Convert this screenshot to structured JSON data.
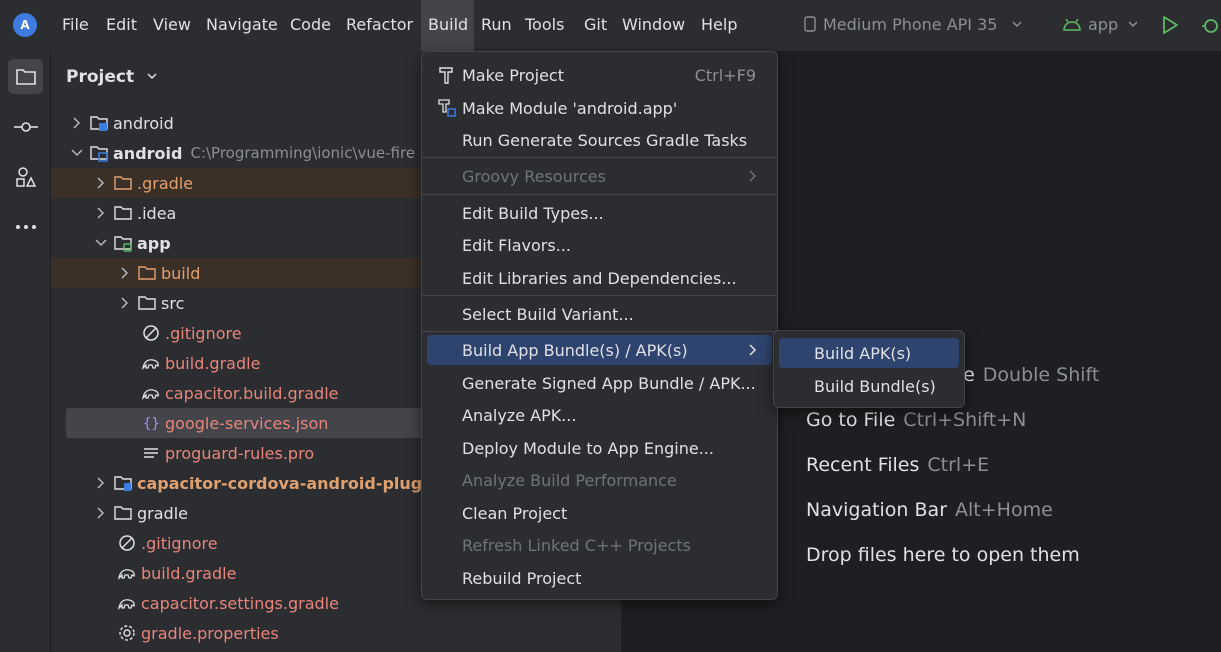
{
  "menubar": {
    "items": [
      {
        "label": "File",
        "mnemonic": "F"
      },
      {
        "label": "Edit",
        "mnemonic": "E"
      },
      {
        "label": "View",
        "mnemonic": "V"
      },
      {
        "label": "Navigate",
        "mnemonic": "N"
      },
      {
        "label": "Code",
        "mnemonic": "C"
      },
      {
        "label": "Refactor",
        "mnemonic": "R"
      },
      {
        "label": "Build",
        "mnemonic": "B"
      },
      {
        "label": "Run",
        "mnemonic": "u"
      },
      {
        "label": "Tools",
        "mnemonic": "T"
      },
      {
        "label": "Git",
        "mnemonic": "G"
      },
      {
        "label": "Window",
        "mnemonic": "W"
      },
      {
        "label": "Help",
        "mnemonic": "H"
      }
    ]
  },
  "toolbar": {
    "device": "Medium Phone API 35",
    "run_config": "app"
  },
  "project_panel": {
    "title": "Project",
    "rows": [
      {
        "label": "android",
        "path": ""
      },
      {
        "label": "android",
        "path": "C:\\Programming\\ionic\\vue-fire"
      },
      {
        "label": ".gradle",
        "path": ""
      },
      {
        "label": ".idea",
        "path": ""
      },
      {
        "label": "app",
        "path": ""
      },
      {
        "label": "build",
        "path": ""
      },
      {
        "label": "src",
        "path": ""
      },
      {
        "label": ".gitignore",
        "path": ""
      },
      {
        "label": "build.gradle",
        "path": ""
      },
      {
        "label": "capacitor.build.gradle",
        "path": ""
      },
      {
        "label": "google-services.json",
        "path": ""
      },
      {
        "label": "proguard-rules.pro",
        "path": ""
      },
      {
        "label": "capacitor-cordova-android-plugi",
        "path": ""
      },
      {
        "label": "gradle",
        "path": ""
      },
      {
        "label": ".gitignore",
        "path": ""
      },
      {
        "label": "build.gradle",
        "path": ""
      },
      {
        "label": "capacitor.settings.gradle",
        "path": ""
      },
      {
        "label": "gradle.properties",
        "path": ""
      }
    ]
  },
  "build_menu": {
    "items": [
      {
        "label": "Make Project",
        "shortcut": "Ctrl+F9"
      },
      {
        "label": "Make Module 'android.app'",
        "shortcut": ""
      },
      {
        "label": "Run Generate Sources Gradle Tasks",
        "shortcut": ""
      },
      {
        "label": "Groovy Resources",
        "shortcut": ""
      },
      {
        "label": "Edit Build Types...",
        "shortcut": ""
      },
      {
        "label": "Edit Flavors...",
        "shortcut": ""
      },
      {
        "label": "Edit Libraries and Dependencies...",
        "shortcut": ""
      },
      {
        "label": "Select Build Variant...",
        "shortcut": ""
      },
      {
        "label": "Build App Bundle(s) / APK(s)",
        "shortcut": ""
      },
      {
        "label": "Generate Signed App Bundle / APK...",
        "shortcut": ""
      },
      {
        "label": "Analyze APK...",
        "shortcut": ""
      },
      {
        "label": "Deploy Module to App Engine...",
        "shortcut": ""
      },
      {
        "label": "Analyze Build Performance",
        "shortcut": ""
      },
      {
        "label": "Clean Project",
        "shortcut": ""
      },
      {
        "label": "Refresh Linked C++ Projects",
        "shortcut": ""
      },
      {
        "label": "Rebuild Project",
        "shortcut": ""
      }
    ]
  },
  "submenu": {
    "items": [
      {
        "label": "Build APK(s)"
      },
      {
        "label": "Build Bundle(s)"
      }
    ]
  },
  "editor_hints": [
    {
      "label": "Search Everywhere",
      "visible_label": "ere",
      "key": "Double Shift"
    },
    {
      "label": "Go to File",
      "key": "Ctrl+Shift+N"
    },
    {
      "label": "Recent Files",
      "key": "Ctrl+E"
    },
    {
      "label": "Navigation Bar",
      "key": "Alt+Home"
    },
    {
      "label": "Drop files here to open them",
      "key": ""
    }
  ],
  "colors": {
    "accent": "#2e436e",
    "background": "#1e1f22",
    "panel": "#2b2d30"
  }
}
